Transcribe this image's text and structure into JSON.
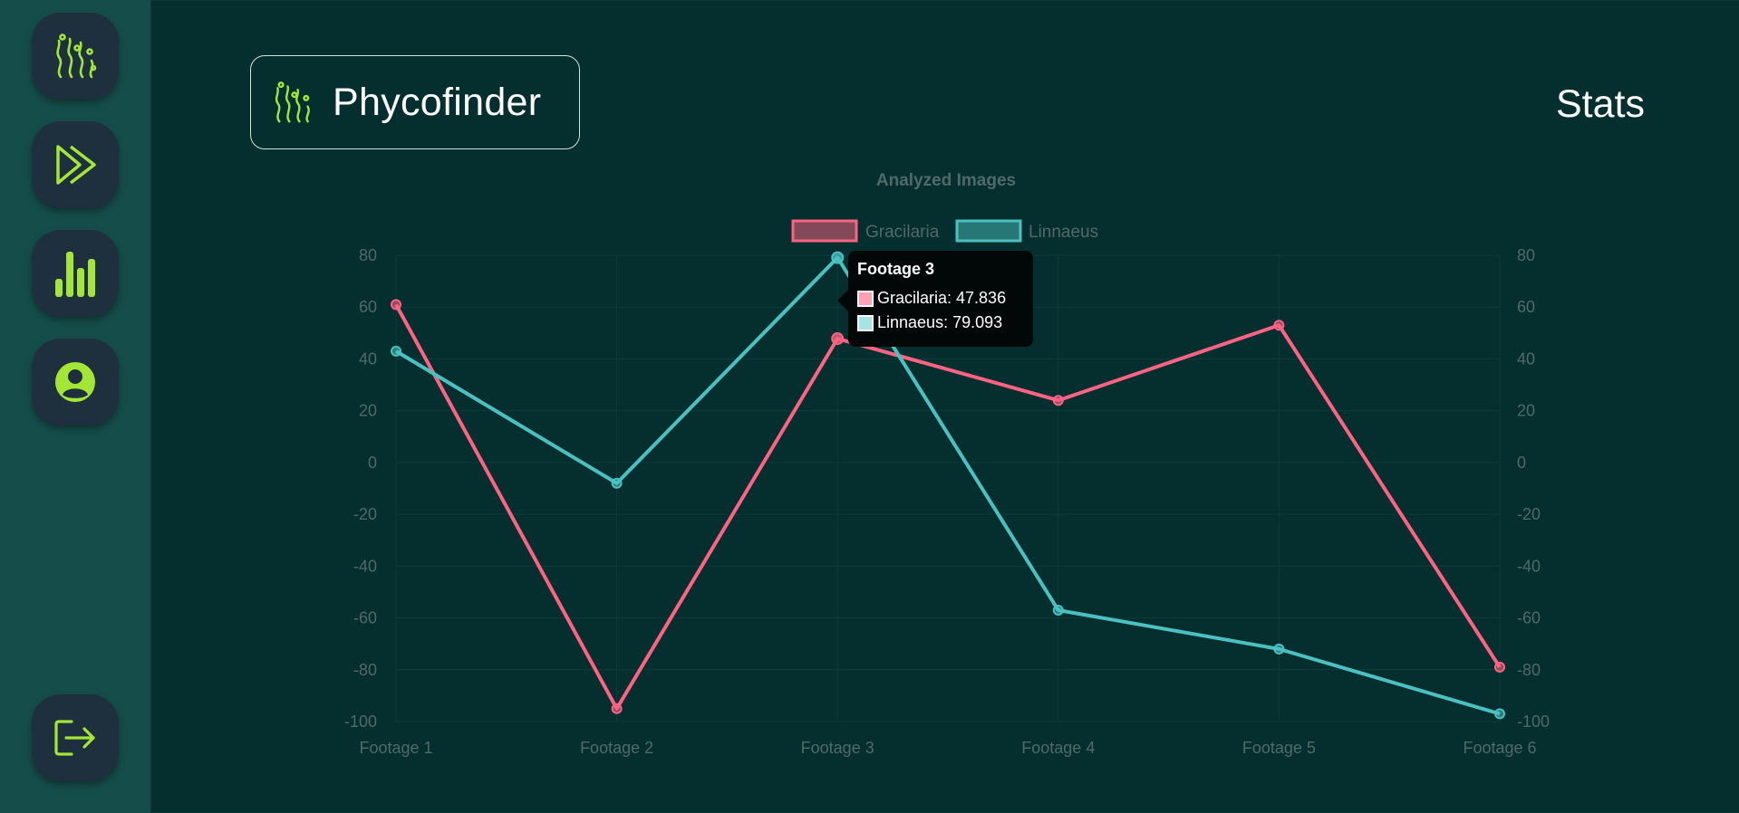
{
  "app": {
    "brand_name": "Phycofinder",
    "page_title": "Stats"
  },
  "sidebar": {
    "items": [
      {
        "name": "seaweed-home",
        "icon": "seaweed-icon"
      },
      {
        "name": "play-analysis",
        "icon": "double-play-icon"
      },
      {
        "name": "stats",
        "icon": "bar-chart-icon"
      },
      {
        "name": "profile",
        "icon": "user-circle-icon"
      },
      {
        "name": "logout",
        "icon": "logout-icon"
      }
    ]
  },
  "colors": {
    "accent": "#a3e635",
    "gracilaria": "#ff6384",
    "linnaeus": "#4bc0c0",
    "background": "#052e2e",
    "sidebar": "#154d4a"
  },
  "chart_data": {
    "type": "line",
    "title": "Analyzed Images",
    "categories": [
      "Footage 1",
      "Footage 2",
      "Footage 3",
      "Footage 4",
      "Footage 5",
      "Footage 6"
    ],
    "series": [
      {
        "name": "Gracilaria",
        "color": "#ff6384",
        "values": [
          61,
          -95,
          47.836,
          24,
          53,
          -79
        ]
      },
      {
        "name": "Linnaeus",
        "color": "#4bc0c0",
        "values": [
          43,
          -8,
          79.093,
          -57,
          -72,
          -97
        ]
      }
    ],
    "ylim": [
      -100,
      80
    ],
    "yticks": [
      80,
      60,
      40,
      20,
      0,
      -20,
      -40,
      -60,
      -80,
      -100
    ],
    "y_axis_sides": [
      "left",
      "right"
    ],
    "grid": true,
    "legend": "top",
    "tooltip": {
      "title": "Footage 3",
      "rows": [
        {
          "label": "Gracilaria: 47.836",
          "swatch": "#ff9fb2"
        },
        {
          "label": "Linnaeus: 79.093",
          "swatch": "#a6e4e4"
        }
      ]
    }
  }
}
